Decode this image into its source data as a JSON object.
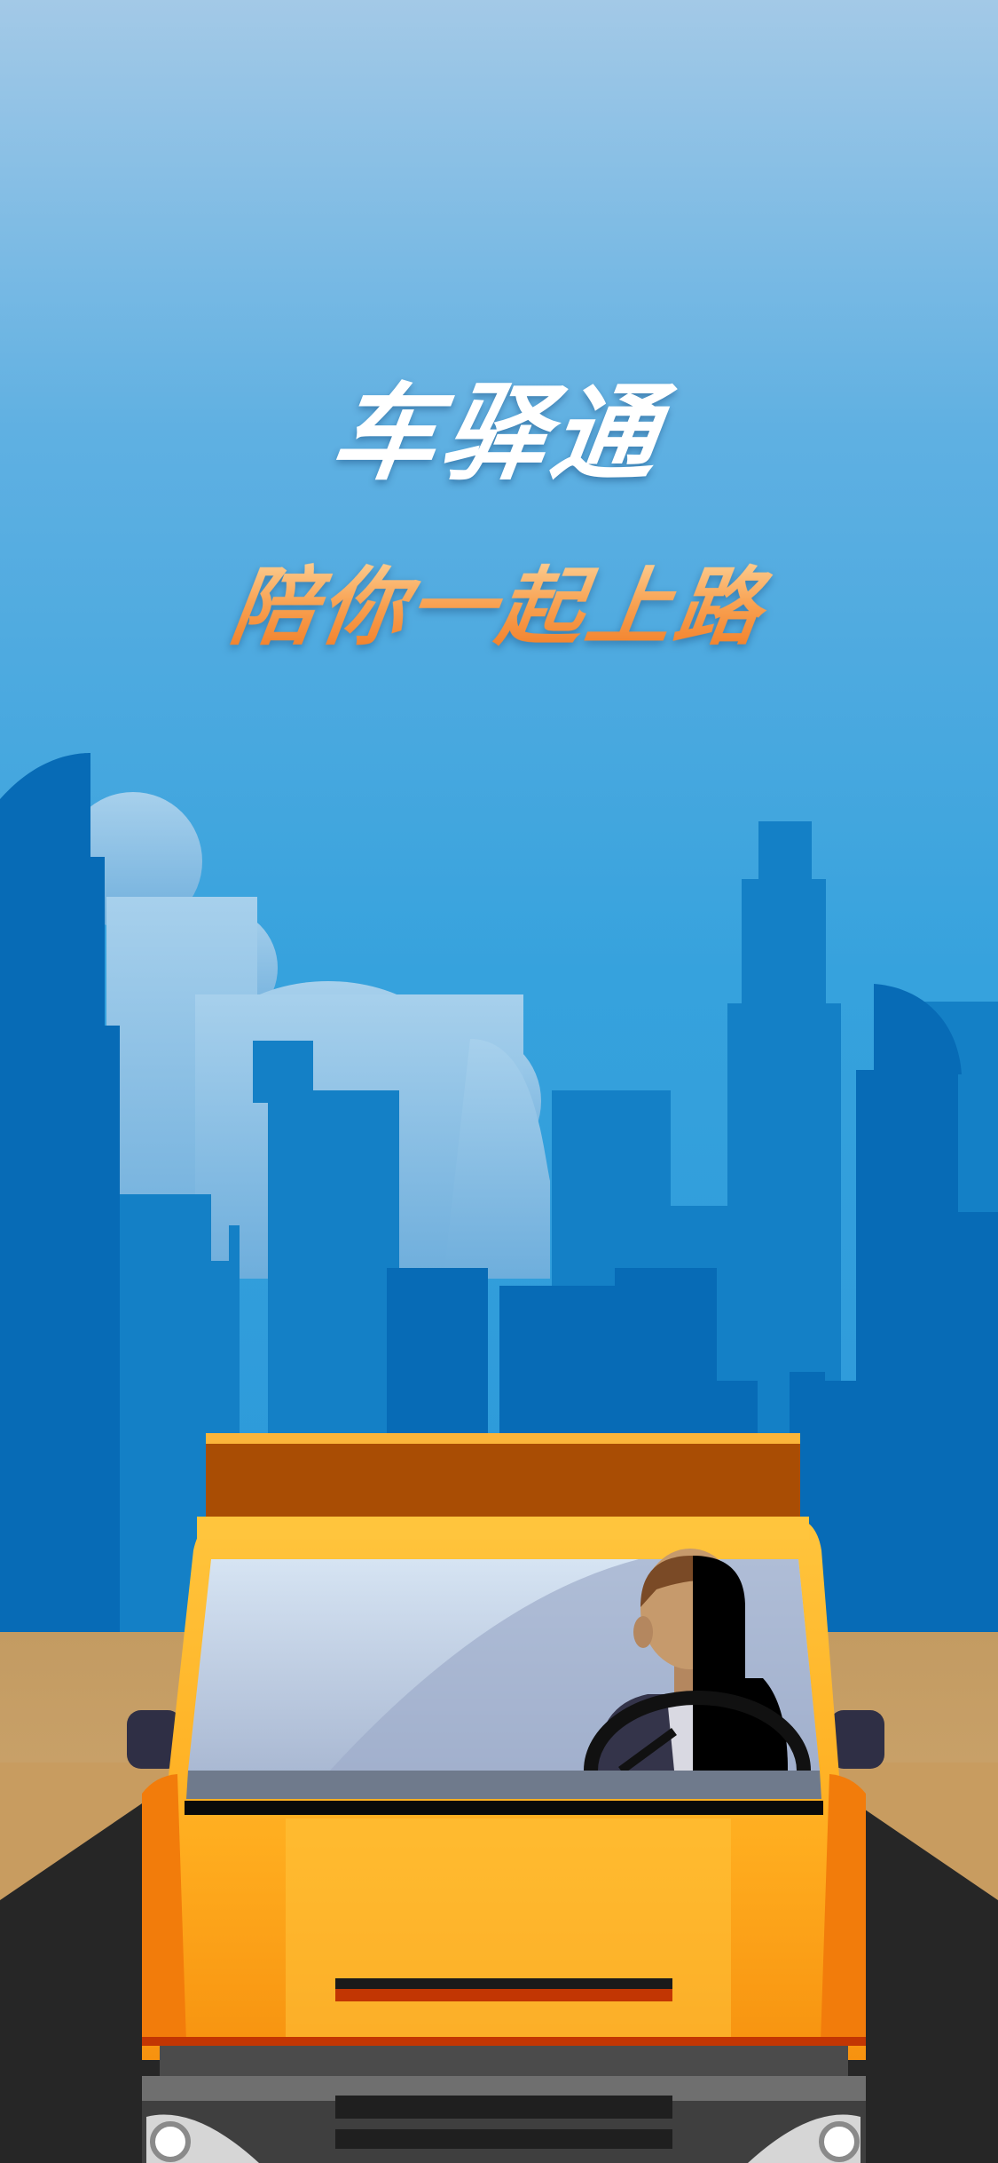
{
  "splash": {
    "app_title": "车驿通",
    "slogan": "陪你一起上路"
  },
  "scene": {
    "illustration": "truck-driving-into-city",
    "colors": {
      "sky_top": "#a3c9e7",
      "sky_bottom": "#2a96d8",
      "buildings_dark": "#076bb6",
      "buildings_mid": "#1480c6",
      "clouds": "#87bde3",
      "truck_body": "#f99a12",
      "truck_cargo": "#a94d04",
      "road": "#262626",
      "ground": "#c69c62"
    }
  }
}
